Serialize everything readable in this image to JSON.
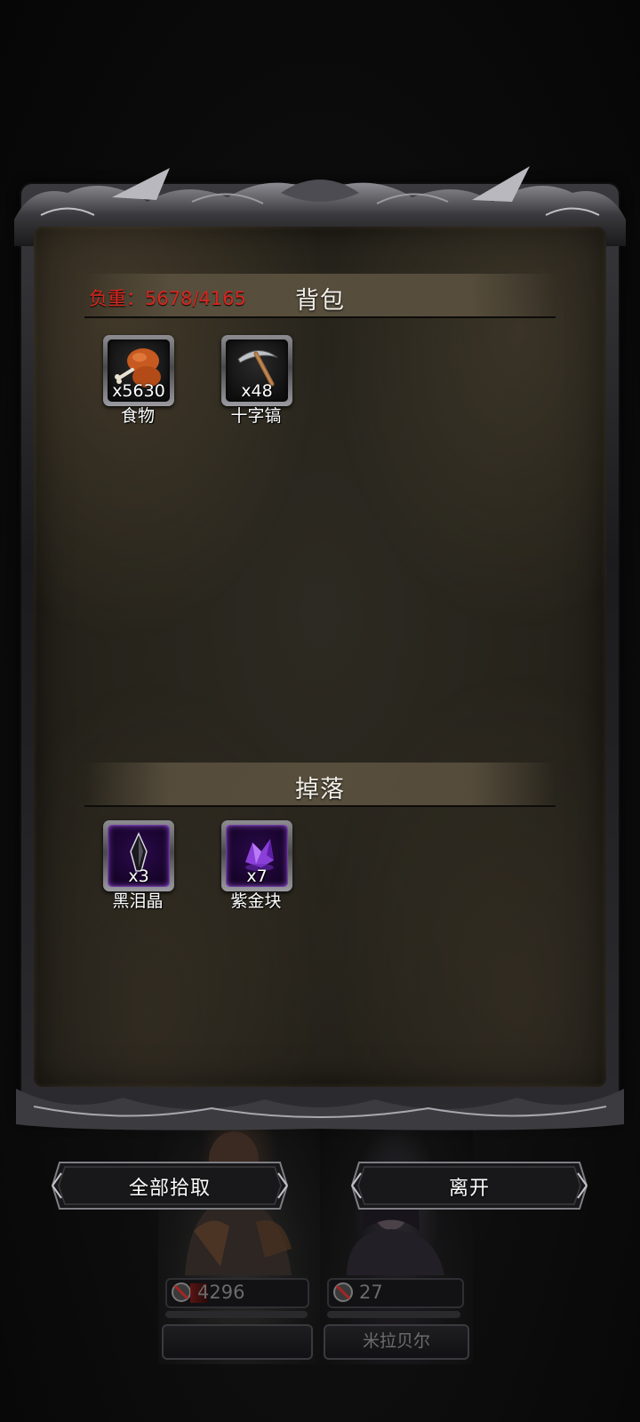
{
  "inventory": {
    "title": "背包",
    "weight_label": "负重：5678/4165",
    "items": [
      {
        "name": "食物",
        "qty": "x5630",
        "icon": "meat-drumstick-icon"
      },
      {
        "name": "十字镐",
        "qty": "x48",
        "icon": "pickaxe-icon"
      }
    ]
  },
  "drops": {
    "title": "掉落",
    "items": [
      {
        "name": "黑泪晶",
        "qty": "x3",
        "icon": "black-tear-crystal-icon",
        "rarity_color": "#7a2fc4"
      },
      {
        "name": "紫金块",
        "qty": "x7",
        "icon": "purple-gold-nugget-icon",
        "rarity_color": "#7a2fc4"
      }
    ]
  },
  "actions": {
    "pickup_all": "全部拾取",
    "leave": "离开"
  },
  "party": [
    {
      "hp": "4296",
      "name": "",
      "icon": "no-entry-icon"
    },
    {
      "hp": "27",
      "name": "米拉贝尔",
      "icon": "no-entry-icon"
    }
  ],
  "colors": {
    "weight_text": "#d8261f",
    "rare_slot": "#7a2fc4",
    "parchment": "#2a261e"
  }
}
